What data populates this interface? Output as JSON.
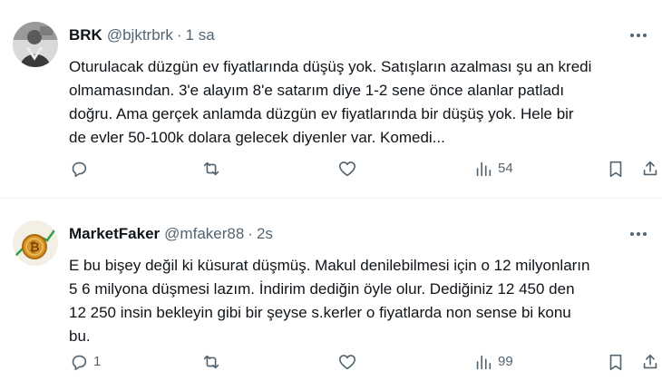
{
  "tweets": [
    {
      "display_name": "BRK",
      "handle": "@bjktrbrk",
      "separator": "·",
      "time": "1 sa",
      "text": "Oturulacak düzgün ev fiyatlarında düşüş yok. Satışların azalması şu an kredi\nolmamasından. 3'e alayım 8'e satarım diye 1-2 sene önce alanlar patladı\ndoğru. Ama gerçek anlamda düzgün ev fiyatlarında bir düşüş yok. Hele bir\nde evler 50-100k dolara gelecek diyenler var. Komedi...",
      "replies": "",
      "retweets": "",
      "likes": "",
      "views": "54",
      "avatar_icon": "profile-photo-person"
    },
    {
      "display_name": "MarketFaker",
      "handle": "@mfaker88",
      "separator": "·",
      "time": "2s",
      "text": "E bu bişey değil ki küsurat düşmüş. Makul denilebilmesi için o 12 milyonların\n5 6 milyona düşmesi lazım. İndirim dediğin öyle olur. Dediğiniz 12 450 den\n12 250 insin bekleyin gibi bir şeyse s.kerler o fiyatlarda non sense bi konu\nbu.",
      "replies": "1",
      "retweets": "",
      "likes": "",
      "views": "99",
      "avatar_icon": "bitcoin-coin-chart"
    }
  ],
  "colors": {
    "text": "#0f1419",
    "secondary": "#536471",
    "divider": "#eff3f4",
    "background": "#ffffff"
  },
  "icons": {
    "reply": "reply-icon",
    "retweet": "retweet-icon",
    "like": "heart-icon",
    "views": "views-chart-icon",
    "bookmark": "bookmark-icon",
    "share": "share-icon",
    "more": "more-options-icon"
  }
}
